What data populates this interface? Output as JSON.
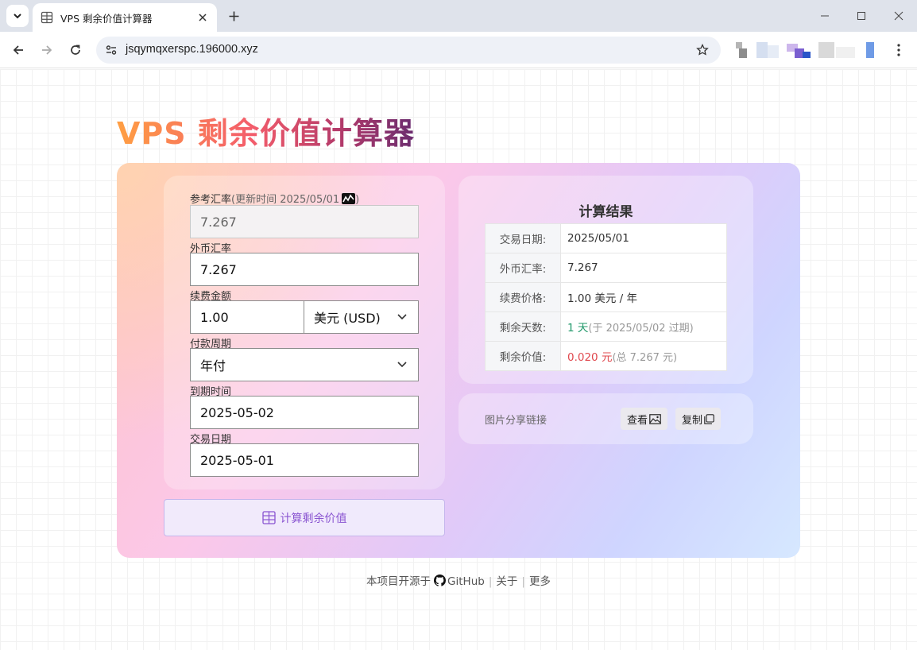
{
  "browser": {
    "tab_title": "VPS 剩余价值计算器",
    "url": "jsqymqxerspc.196000.xyz"
  },
  "page": {
    "title": "VPS 剩余价值计算器",
    "form": {
      "ref_rate_label": "参考汇率",
      "ref_rate_note": "(更新时间 2025/05/01",
      "ref_rate_note_close": ")",
      "ref_rate_value": "7.267",
      "fx_rate_label": "外币汇率",
      "fx_rate_value": "7.267",
      "renewal_label": "续费金额",
      "renewal_value": "1.00",
      "currency_selected": "美元 (USD)",
      "cycle_label": "付款周期",
      "cycle_selected": "年付",
      "expiry_label": "到期时间",
      "expiry_value": "2025-05-02",
      "trade_label": "交易日期",
      "trade_value": "2025-05-01",
      "calc_button": "计算剩余价值"
    },
    "result": {
      "title": "计算结果",
      "rows": [
        {
          "key": "交易日期:",
          "value": "2025/05/01"
        },
        {
          "key": "外币汇率:",
          "value": "7.267"
        },
        {
          "key": "续费价格:",
          "value": "1.00 美元 / 年"
        },
        {
          "key": "剩余天数:",
          "value": "1 天",
          "note": "(于 2025/05/02 过期)"
        },
        {
          "key": "剩余价值:",
          "value": "0.020 元",
          "note": "(总 7.267 元)"
        }
      ]
    },
    "share": {
      "label": "图片分享链接",
      "view_button": "查看",
      "copy_button": "复制"
    },
    "footer": {
      "prefix": "本项目开源于",
      "github": "GitHub",
      "about": "关于",
      "more": "更多"
    }
  },
  "colors": {
    "accent": "#8a55d1",
    "days_green": "#20986a",
    "value_red": "#e0484e"
  }
}
